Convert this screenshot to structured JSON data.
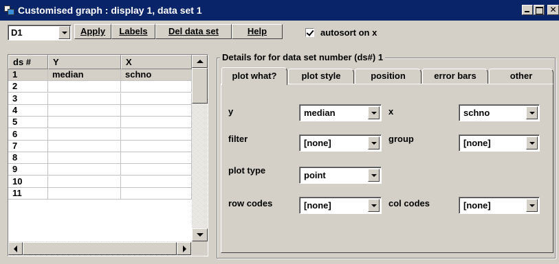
{
  "window": {
    "title": "Customised graph : display 1, data set 1"
  },
  "toolbar": {
    "display_select": "D1",
    "apply_label": "Apply",
    "labels_label": "Labels",
    "del_data_set_label": "Del data set",
    "help_label": "Help",
    "autosort_label": "autosort on x",
    "autosort_checked": true
  },
  "grid": {
    "headers": [
      "ds #",
      "Y",
      "X"
    ],
    "rows": [
      {
        "ds": "1",
        "y": "median",
        "x": "schno"
      },
      {
        "ds": "2",
        "y": "",
        "x": ""
      },
      {
        "ds": "3",
        "y": "",
        "x": ""
      },
      {
        "ds": "4",
        "y": "",
        "x": ""
      },
      {
        "ds": "5",
        "y": "",
        "x": ""
      },
      {
        "ds": "6",
        "y": "",
        "x": ""
      },
      {
        "ds": "7",
        "y": "",
        "x": ""
      },
      {
        "ds": "8",
        "y": "",
        "x": ""
      },
      {
        "ds": "9",
        "y": "",
        "x": ""
      },
      {
        "ds": "10",
        "y": "",
        "x": ""
      },
      {
        "ds": "11",
        "y": "",
        "x": ""
      }
    ]
  },
  "details": {
    "group_label": "Details for for data set number (ds#) 1",
    "tabs": [
      "plot what?",
      "plot style",
      "position",
      "error bars",
      "other"
    ],
    "active_tab": "plot what?",
    "fields": {
      "y_label": "y",
      "y_value": "median",
      "x_label": "x",
      "x_value": "schno",
      "filter_label": "filter",
      "filter_value": "[none]",
      "group_label": "group",
      "group_value": "[none]",
      "plot_type_label": "plot type",
      "plot_type_value": "point",
      "row_codes_label": "row codes",
      "row_codes_value": "[none]",
      "col_codes_label": "col codes",
      "col_codes_value": "[none]"
    }
  }
}
